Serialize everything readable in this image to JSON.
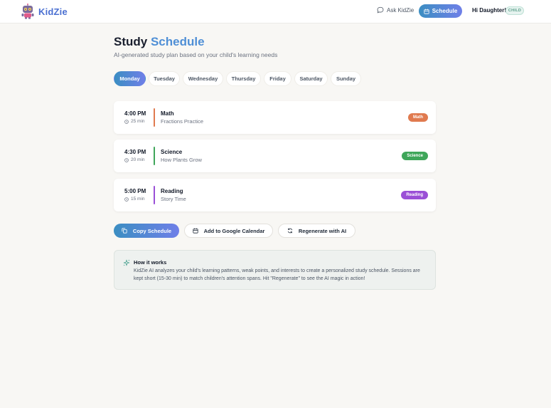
{
  "header": {
    "brand": "KidZie",
    "ask_label": "Ask KidZie",
    "schedule_label": "Schedule",
    "greeting": "Hi Daughter!",
    "role_badge": "CHILD"
  },
  "page": {
    "title_main": "Study",
    "title_accent": "Schedule",
    "subtitle": "AI-generated study plan based on your child's learning needs"
  },
  "days": [
    "Monday",
    "Tuesday",
    "Wednesday",
    "Thursday",
    "Friday",
    "Saturday",
    "Sunday"
  ],
  "selected_day": "Monday",
  "sessions": [
    {
      "time": "4:00 PM",
      "duration": "25 min",
      "subject": "Math",
      "topic": "Fractions Practice",
      "tag": "Math",
      "color": "#e07a4f"
    },
    {
      "time": "4:30 PM",
      "duration": "20 min",
      "subject": "Science",
      "topic": "How Plants Grow",
      "tag": "Science",
      "color": "#3fa65a"
    },
    {
      "time": "5:00 PM",
      "duration": "15 min",
      "subject": "Reading",
      "topic": "Story Time",
      "tag": "Reading",
      "color": "#9a4fd6"
    }
  ],
  "actions": {
    "copy": "Copy Schedule",
    "google": "Add to Google Calendar",
    "regenerate": "Regenerate with AI"
  },
  "info": {
    "heading": "How it works",
    "body": "KidZie AI analyzes your child's learning patterns, weak points, and interests to create a personalized study schedule. Sessions are kept short (15-30 min) to match children's attention spans. Hit \"Regenerate\" to see the AI magic in action!"
  },
  "colors": {
    "accent_gradient_start": "#3b8ec2",
    "accent_gradient_end": "#6f7fe8",
    "brand": "#4a6fd1"
  },
  "icons": {
    "logo": "robot-logo-icon",
    "ask": "chat-bubble-icon",
    "schedule": "calendar-icon",
    "duration": "clock-icon",
    "copy": "copy-icon",
    "google": "calendar-icon",
    "regenerate": "refresh-icon",
    "info": "sparkles-icon"
  }
}
